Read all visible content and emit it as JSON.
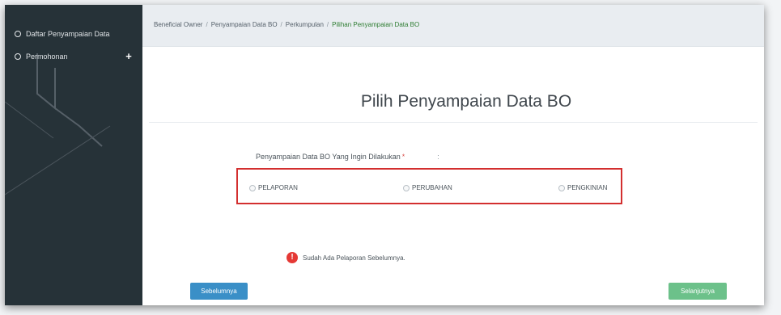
{
  "sidebar": {
    "items": [
      {
        "label": "Daftar Penyampaian Data"
      },
      {
        "label": "Permohonan"
      }
    ],
    "plus_icon": "+"
  },
  "breadcrumb": {
    "items": [
      "Beneficial Owner",
      "Penyampaian Data BO",
      "Perkumpulan"
    ],
    "active": "Pilihan Penyampaian Data BO",
    "separator": "/"
  },
  "main": {
    "title": "Pilih Penyampaian Data BO",
    "field_label": "Penyampaian Data BO Yang Ingin Dilakukan",
    "required_mark": "*",
    "colon": ":",
    "options": [
      "PELAPORAN",
      "PERUBAHAN",
      "PENGKINIAN"
    ],
    "warning_icon": "!",
    "warning_text": "Sudah Ada Pelaporan Sebelumnya."
  },
  "buttons": {
    "prev_label": "Sebelumnya",
    "next_label": "Selanjutnya"
  },
  "colors": {
    "sidebar_bg": "#263238",
    "highlight_border": "#d32f2f",
    "prev_button": "#3a8fc7",
    "next_button": "#6cc18a",
    "breadcrumb_active": "#2e7d32",
    "warning_icon": "#e53935"
  }
}
